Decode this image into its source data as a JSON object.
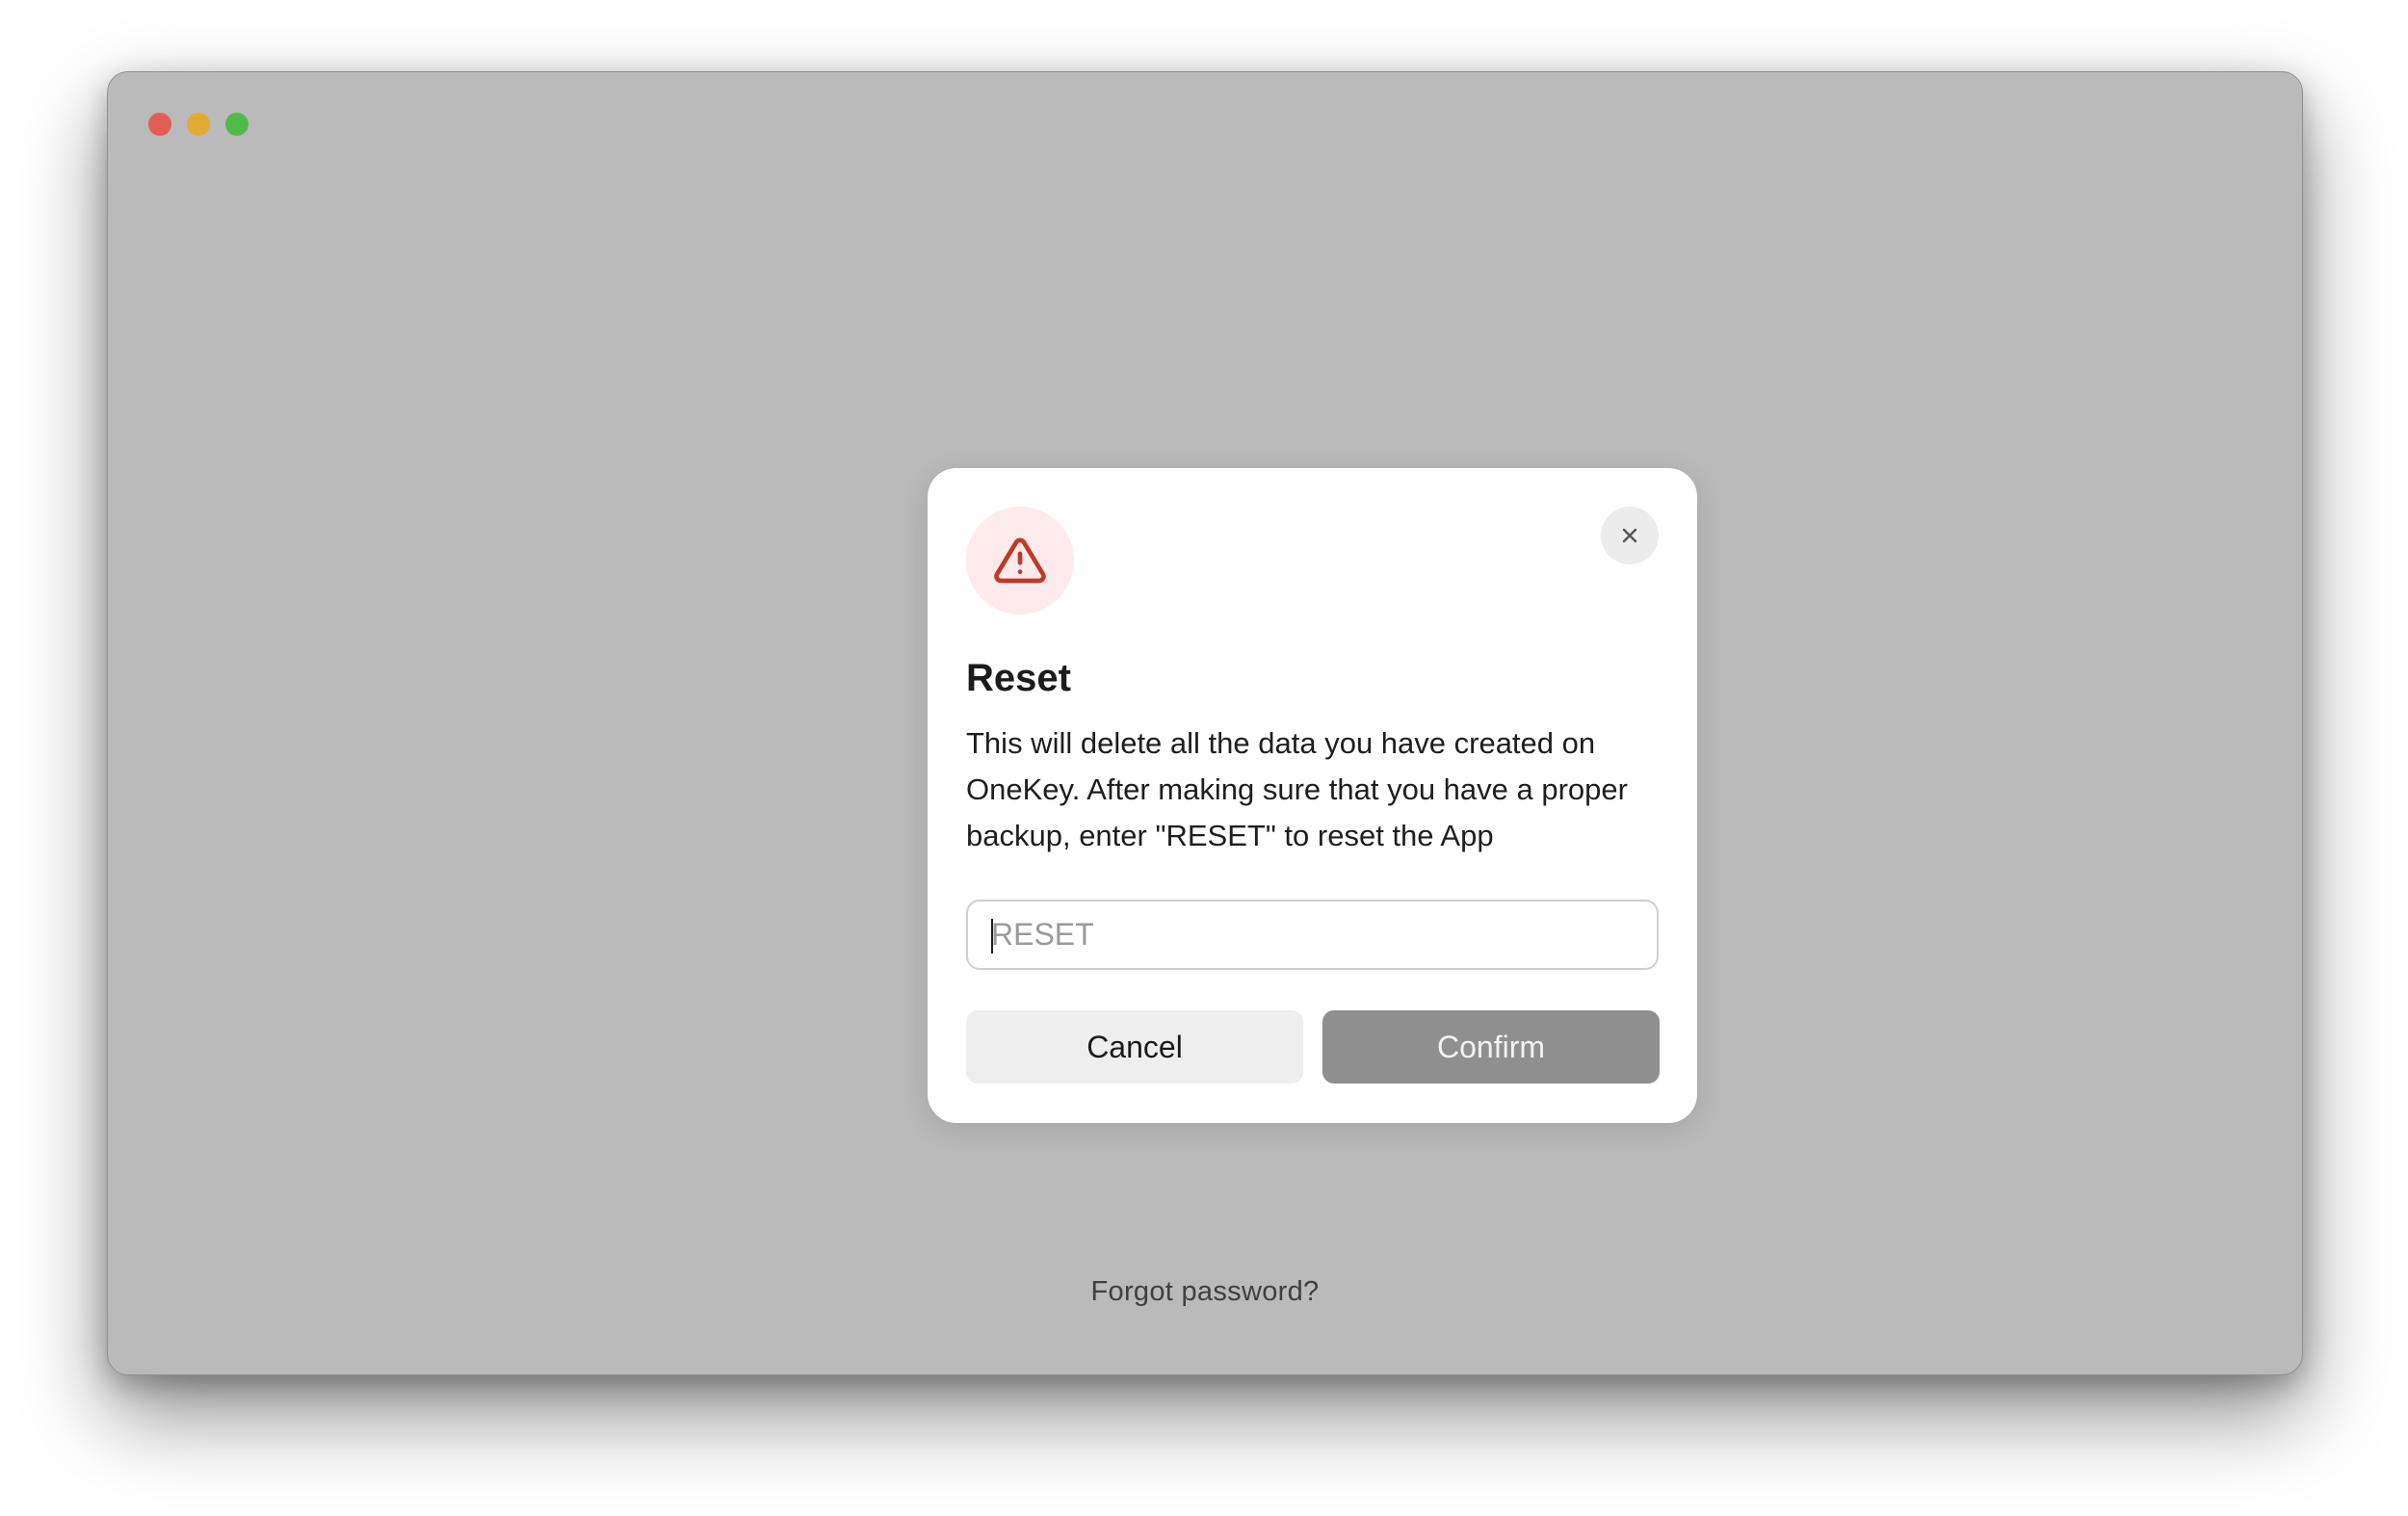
{
  "window": {
    "controls": [
      "close",
      "minimize",
      "maximize"
    ],
    "background_color": "#bababa"
  },
  "dialog": {
    "icon": "warning-triangle-icon",
    "icon_color": "#c0392b",
    "close_icon": "close-icon",
    "title": "Reset",
    "message": "This will delete all the data you have created on OneKey. After making sure that you have a proper backup, enter \"RESET\" to reset the App",
    "input": {
      "value": "",
      "placeholder": "RESET"
    },
    "cancel_label": "Cancel",
    "confirm_label": "Confirm",
    "confirm_state": "disabled"
  },
  "footer": {
    "forgot_password_label": "Forgot password?"
  }
}
